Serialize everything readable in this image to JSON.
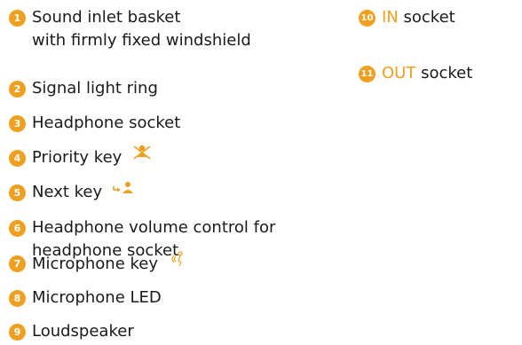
{
  "colors": {
    "badge": "#f0a020",
    "text": "#1a1a1a",
    "keyword": "#f0a020"
  },
  "legend_left": [
    {
      "number": "1",
      "lines": [
        "Sound inlet basket",
        "with firmly fixed windshield"
      ]
    },
    {
      "number": "2",
      "lines": [
        "Signal light ring"
      ]
    },
    {
      "number": "3",
      "lines": [
        "Headphone socket"
      ]
    },
    {
      "number": "4",
      "lines": [
        "Priority key"
      ],
      "icon": "priority-key-icon"
    },
    {
      "number": "5",
      "lines": [
        "Next key"
      ],
      "icon": "next-key-icon"
    },
    {
      "number": "6",
      "lines": [
        "Headphone volume control for",
        "headphone socket"
      ]
    },
    {
      "number": "7",
      "lines": [
        "Microphone key"
      ],
      "icon": "microphone-key-icon"
    },
    {
      "number": "8",
      "lines": [
        "Microphone LED"
      ]
    },
    {
      "number": "9",
      "lines": [
        "Loudspeaker"
      ]
    }
  ],
  "legend_right": [
    {
      "number": "10",
      "keyword": "IN",
      "text": "socket"
    },
    {
      "number": "11",
      "keyword": "OUT",
      "text": "socket"
    }
  ]
}
